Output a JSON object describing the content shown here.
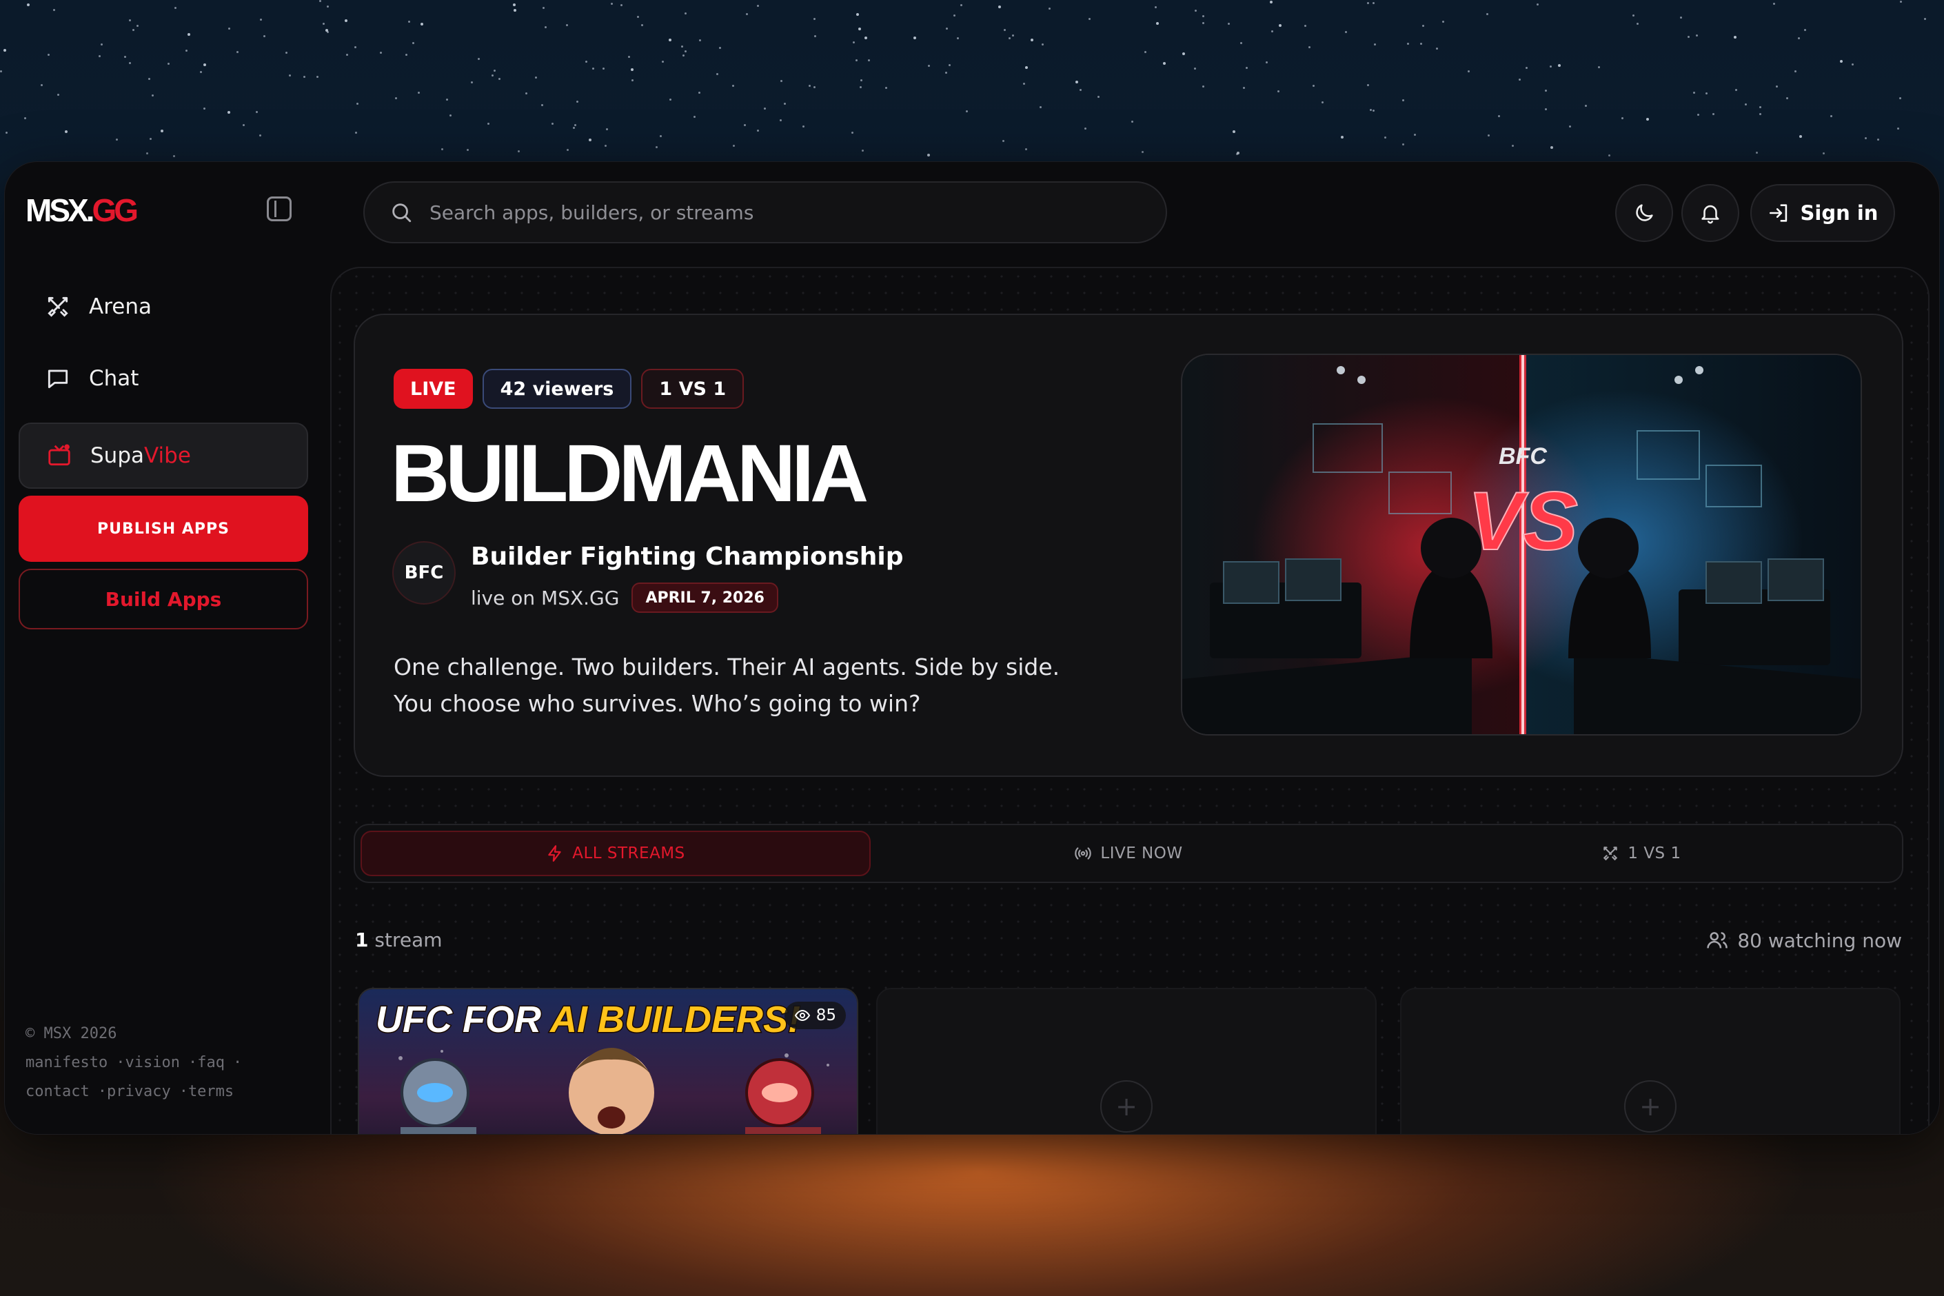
{
  "app": {
    "logo_left": "MSX.",
    "logo_right": "GG"
  },
  "sidebar": {
    "items": [
      {
        "label": "Arena",
        "icon": "swords-icon"
      },
      {
        "label": "Chat",
        "icon": "chat-bubble-icon"
      },
      {
        "label_a": "Supa",
        "label_b": "Vibe",
        "icon": "tv-icon"
      }
    ],
    "publish_label": "PUBLISH APPS",
    "build_label": "Build Apps",
    "footer": {
      "copyright": "© MSX 2026",
      "links": [
        "manifesto",
        "vision",
        "faq",
        "contact",
        "privacy",
        "terms"
      ]
    }
  },
  "topbar": {
    "search_placeholder": "Search apps, builders, or streams",
    "signin_label": "Sign in"
  },
  "hero": {
    "badges": {
      "live": "LIVE",
      "viewers": "42 viewers",
      "mode": "1 VS 1"
    },
    "title": "BUILDMANIA",
    "org_avatar": "BFC",
    "org_name": "Builder Fighting Championship",
    "org_sub": "live on MSX.GG",
    "date": "APRIL 7, 2026",
    "description": "One challenge. Two builders. Their AI agents. Side by side. You choose who survives. Who’s going to win?",
    "image_text": {
      "logo": "BFC",
      "vs": "VS"
    }
  },
  "tabs": [
    {
      "label": "ALL STREAMS",
      "icon": "bolt-icon",
      "active": true
    },
    {
      "label": "LIVE NOW",
      "icon": "broadcast-icon",
      "active": false
    },
    {
      "label": "1 VS 1",
      "icon": "swords-icon",
      "active": false
    }
  ],
  "streams": {
    "count_num": "1",
    "count_label": "stream",
    "watching": "80 watching now",
    "cards": [
      {
        "thumbnail_text_a": "UFC FOR ",
        "thumbnail_text_b": "AI BUILDERS!",
        "views": "85"
      }
    ],
    "empty_plus": "+"
  },
  "colors": {
    "accent": "#e0121f",
    "background": "#0b0b0d",
    "panel": "#121214"
  }
}
